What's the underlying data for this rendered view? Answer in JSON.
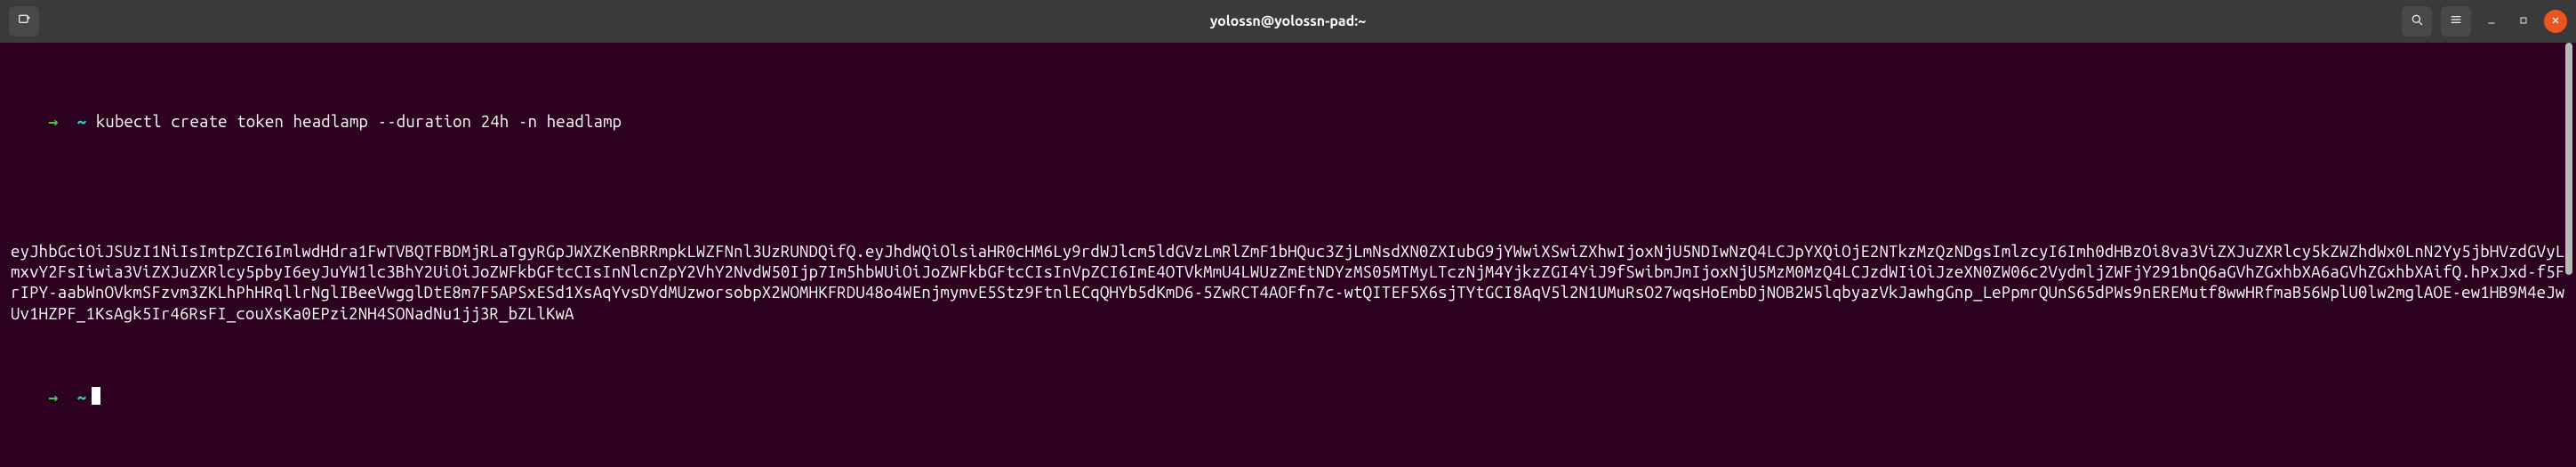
{
  "titlebar": {
    "title": "yolossn@yolossn-pad:~",
    "icons": {
      "new_tab": "new-tab-icon",
      "search": "search-icon",
      "menu": "hamburger-menu-icon",
      "minimize": "minimize-icon",
      "maximize": "maximize-icon",
      "close": "close-icon"
    }
  },
  "terminal": {
    "prompt_arrow": "→",
    "prompt_path": "~",
    "command": "kubectl create token headlamp --duration 24h -n headlamp",
    "output": "eyJhbGciOiJSUzI1NiIsImtpZCI6ImlwdHdra1FwTVBQTFBDMjRLaTgyRGpJWXZKenBRRmpkLWZFNnl3UzRUNDQifQ.eyJhdWQiOlsiaHR0cHM6Ly9rdWJlcm5ldGVzLmRlZmF1bHQuc3ZjLmNsdXN0ZXIubG9jYWwiXSwiZXhwIjoxNjU5NDIwNzQ4LCJpYXQiOjE2NTkzMzQzNDgsImlzcyI6Imh0dHBzOi8va3ViZXJuZXRlcy5kZWZhdWx0LnN2Yy5jbHVzdGVyLmxvY2FsIiwia3ViZXJuZXRlcy5pbyI6eyJuYW1lc3BhY2UiOiJoZWFkbGFtcCIsInNlcnZpY2VhY2NvdW50Ijp7Im5hbWUiOiJoZWFkbGFtcCIsInVpZCI6ImE4OTVkMmU4LWUzZmEtNDYzMS05MTMyLTczNjM4YjkzZGI4YiJ9fSwibmJmIjoxNjU5MzM0MzQ4LCJzdWIiOiJzeXN0ZW06c2VydmljZWFjY291bnQ6aGVhZGxhbXA6aGVhZGxhbXAifQ.hPxJxd-f5FrIPY-aabWnOVkmSFzvm3ZKLhPhHRqllrNglIBeeVwgglDtE8m7F5APSxESd1XsAqYvsDYdMUzworsobpX2WOMHKFRDU48o4WEnjmymvE5Stz9FtnlECqQHYb5dKmD6-5ZwRCT4AOFfn7c-wtQITEF5X6sjTYtGCI8AqV5l2N1UMuRsO27wqsHoEmbDjNOB2W5lqbyazVkJawhgGnp_LePpmrQUnS65dPWs9nEREMutf8wwHRfmaB56WplU0lw2mglAOE-ew1HB9M4eJwUv1HZPF_1KsAgk5Ir46RsFI_couXsKa0EPzi2NH4SONadNu1jj3R_bZLlKwA",
    "second_prompt_arrow": "→",
    "second_prompt_path": "~"
  }
}
